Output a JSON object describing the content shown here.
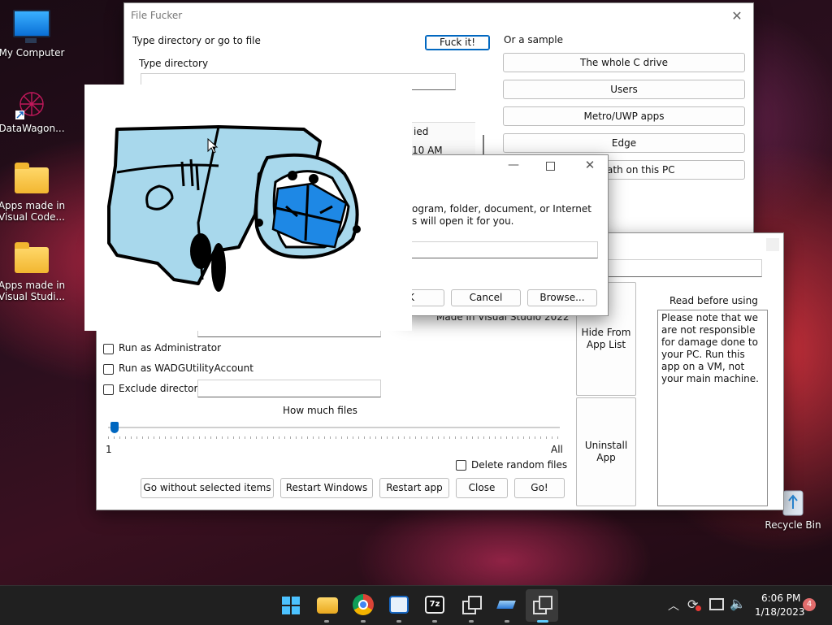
{
  "desktop": {
    "icons": [
      {
        "label": "My Computer",
        "icon": "computer-icon"
      },
      {
        "label": "DataWagon...",
        "icon": "shortcut-icon"
      },
      {
        "label": "Apps made in Visual Code...",
        "icon": "folder-icon"
      },
      {
        "label": "Apps made in Visual Studi...",
        "icon": "folder-icon"
      }
    ],
    "recycle_bin": "Recycle Bin"
  },
  "file_window": {
    "title": "File Fucker",
    "directory_prompt": "Type directory or go to file",
    "go_button": "Fuck it!",
    "type_directory_label": "Type directory",
    "partial_text_1": "ied",
    "partial_text_2": "10 AM",
    "sample_label": "Or a sample",
    "samples": [
      "The whole C drive",
      "Users",
      "Metro/UWP apps",
      "Edge",
      "o do math on this PC"
    ]
  },
  "run_dialog": {
    "desc_line1": "ogram, folder, document, or Internet",
    "desc_line2": "s will open it for you.",
    "ok_fragment": "K",
    "cancel": "Cancel",
    "browse": "Browse..."
  },
  "main_window": {
    "made_in": "Made in Visual Studio 2022",
    "options": [
      "Run as Administrator",
      "Run as WADGUtilityAccount",
      "Exclude directory:"
    ],
    "slider_label": "How much files",
    "slider_min": "1",
    "slider_max": "All",
    "slider_value": 0,
    "delete_random": "Delete random files",
    "buttons": [
      "Go without selected items",
      "Restart Windows",
      "Restart app",
      "Close",
      "Go!"
    ],
    "hide_button": "Hide From App List",
    "uninstall_button": "Uninstall App",
    "read_label": "Read before using",
    "read_text": "Please note that we are not responsible for damage done to your PC. Run this app on a VM, not your main machine."
  },
  "taskbar": {
    "time": "6:06 PM",
    "date": "1/18/2023",
    "badge": "4"
  }
}
